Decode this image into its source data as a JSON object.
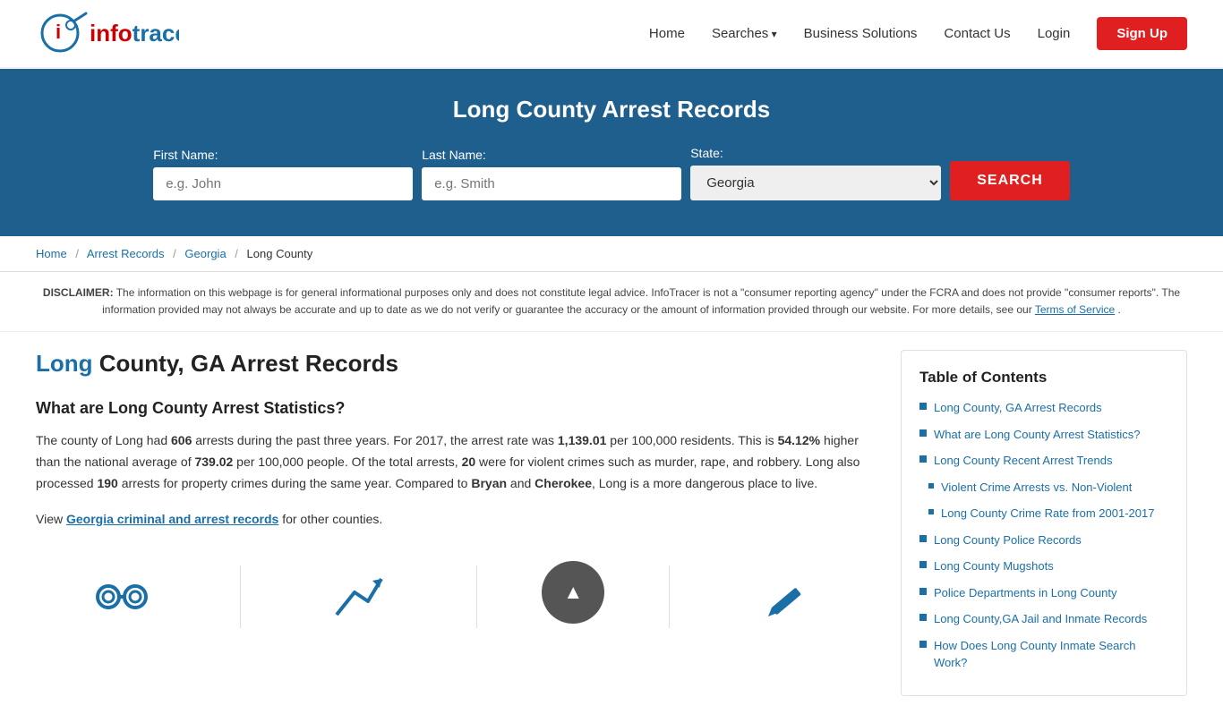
{
  "nav": {
    "home_label": "Home",
    "searches_label": "Searches",
    "business_label": "Business Solutions",
    "contact_label": "Contact Us",
    "login_label": "Login",
    "signup_label": "Sign Up"
  },
  "hero": {
    "title": "Long County Arrest Records",
    "first_name_label": "First Name:",
    "first_name_placeholder": "e.g. John",
    "last_name_label": "Last Name:",
    "last_name_placeholder": "e.g. Smith",
    "state_label": "State:",
    "state_value": "Georgia",
    "search_label": "SEARCH"
  },
  "breadcrumb": {
    "home": "Home",
    "arrest_records": "Arrest Records",
    "georgia": "Georgia",
    "long_county": "Long County"
  },
  "disclaimer": {
    "bold": "DISCLAIMER:",
    "text": " The information on this webpage is for general informational purposes only and does not constitute legal advice. InfoTracer is not a \"consumer reporting agency\" under the FCRA and does not provide \"consumer reports\". The information provided may not always be accurate and up to date as we do not verify or guarantee the accuracy or the amount of information provided through our website. For more details, see our ",
    "tos_link": "Terms of Service",
    "tos_end": "."
  },
  "article": {
    "title_highlight": "Long",
    "title_rest": " County, GA Arrest Records",
    "section1_heading": "What are Long County Arrest Statistics?",
    "section1_para": "The county of Long had ",
    "arrests_count": "606",
    "s1p2": " arrests during the past three years. For 2017, the arrest rate was ",
    "rate_2017": "1,139.01",
    "s1p3": " per 100,000 residents. This is ",
    "pct_higher": "54.12%",
    "s1p4": " higher than the national average of ",
    "national_avg": "739.02",
    "s1p5": " per 100,000 people. Of the total arrests, ",
    "violent_count": "20",
    "s1p6": " were for violent crimes such as murder, rape, and robbery. Long also processed ",
    "property_count": "190",
    "s1p7": " arrests for property crimes during the same year. Compared to ",
    "county1": "Bryan",
    "s1p8": " and ",
    "county2": "Cherokee",
    "s1p9": ", Long is a more dangerous place to live.",
    "view_text": "View ",
    "view_link_text": "Georgia criminal and arrest records",
    "view_end": " for other counties."
  },
  "toc": {
    "heading": "Table of Contents",
    "items": [
      {
        "label": "Long County, GA Arrest Records",
        "sub": false
      },
      {
        "label": "What are Long County Arrest Statistics?",
        "sub": false
      },
      {
        "label": "Long County Recent Arrest Trends",
        "sub": false
      },
      {
        "label": "Violent Crime Arrests vs. Non-Violent",
        "sub": true
      },
      {
        "label": "Long County Crime Rate from 2001-2017",
        "sub": true
      },
      {
        "label": "Long County Police Records",
        "sub": false
      },
      {
        "label": "Long County Mugshots",
        "sub": false
      },
      {
        "label": "Police Departments in Long County",
        "sub": false
      },
      {
        "label": "Long County,GA Jail and Inmate Records",
        "sub": false
      },
      {
        "label": "How Does Long County Inmate Search Work?",
        "sub": false
      }
    ]
  }
}
